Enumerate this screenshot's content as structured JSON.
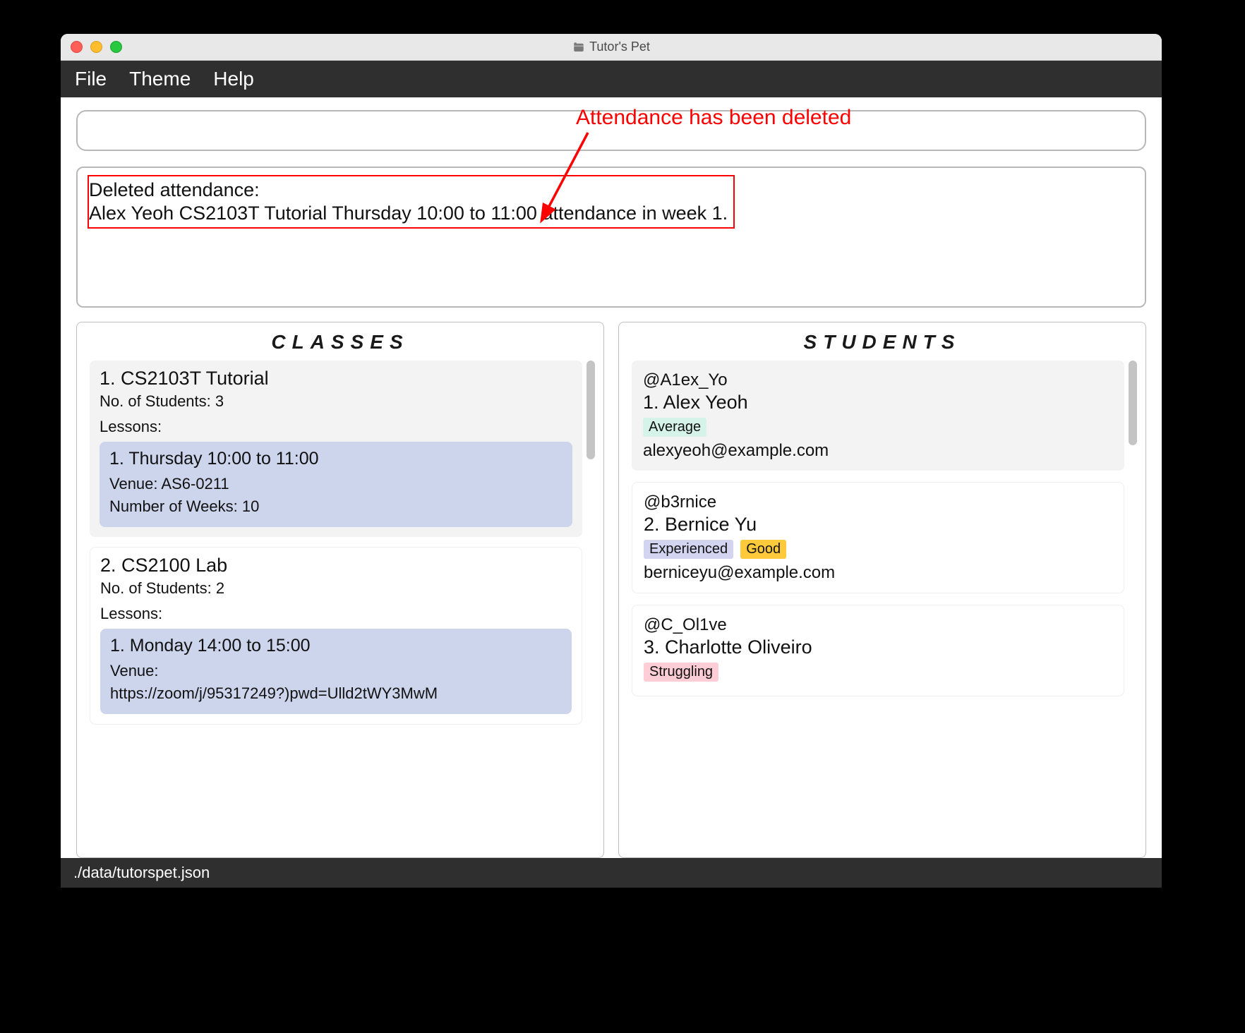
{
  "window": {
    "title": "Tutor's Pet"
  },
  "menubar": {
    "file": "File",
    "theme": "Theme",
    "help": "Help"
  },
  "annotation": {
    "label": "Attendance has been deleted"
  },
  "result": {
    "header": "Deleted attendance:",
    "detail": "Alex Yeoh CS2103T Tutorial Thursday 10:00 to 11:00 attendance in week 1."
  },
  "panels": {
    "classes": {
      "title": "CLASSES",
      "items": [
        {
          "title": "1.  CS2103T Tutorial",
          "students_label": "No. of Students:  3",
          "lessons_label": "Lessons:",
          "lessons": [
            {
              "time": "1. Thursday 10:00 to 11:00",
              "venue": "Venue: AS6-0211",
              "weeks": "Number of Weeks: 10"
            }
          ]
        },
        {
          "title": "2.  CS2100 Lab",
          "students_label": "No. of Students:  2",
          "lessons_label": "Lessons:",
          "lessons": [
            {
              "time": "1. Monday 14:00 to 15:00",
              "venue": "Venue:",
              "venue2": "https://zoom/j/95317249?)pwd=Ulld2tWY3MwM"
            }
          ]
        }
      ]
    },
    "students": {
      "title": "STUDENTS",
      "items": [
        {
          "handle": "@A1ex_Yo",
          "name": "1.  Alex Yeoh",
          "tags": [
            {
              "label": "Average",
              "color": "#d5f3e9"
            }
          ],
          "email": "alexyeoh@example.com"
        },
        {
          "handle": "@b3rnice",
          "name": "2.  Bernice Yu",
          "tags": [
            {
              "label": "Experienced",
              "color": "#d2d4f0"
            },
            {
              "label": "Good",
              "color": "#ffc93c"
            }
          ],
          "email": "berniceyu@example.com"
        },
        {
          "handle": "@C_Ol1ve",
          "name": "3.  Charlotte Oliveiro",
          "tags": [
            {
              "label": "Struggling",
              "color": "#ffcdd6"
            }
          ],
          "email": ""
        }
      ]
    }
  },
  "statusbar": {
    "path": "./data/tutorspet.json"
  },
  "scroll": {
    "classes": {
      "top": 0,
      "height": 140
    },
    "students": {
      "top": 0,
      "height": 120
    }
  }
}
